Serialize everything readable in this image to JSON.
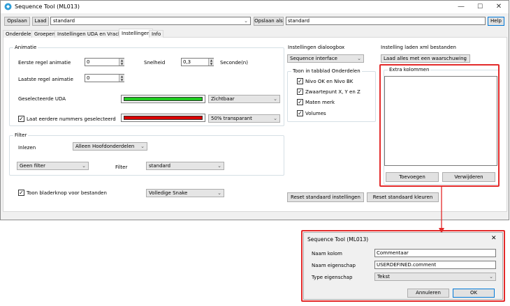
{
  "window": {
    "title": "Sequence Tool (ML013)",
    "minimize": "—",
    "maximize": "☐",
    "close": "✕"
  },
  "toolbar": {
    "save_label": "Opslaan",
    "load_label": "Laad",
    "profile_value": "standard",
    "save_as_label": "Opslaan als",
    "save_as_value": "standard",
    "help_label": "Help"
  },
  "tabs": [
    {
      "label": "Onderdelen"
    },
    {
      "label": "Groepen"
    },
    {
      "label": "Instellingen UDA en Vrachten"
    },
    {
      "label": "Instellingen"
    },
    {
      "label": "Info"
    }
  ],
  "animatie": {
    "title": "Animatie",
    "first_line_label": "Eerste regel animatie",
    "first_line_value": "0",
    "speed_label": "Snelheid",
    "speed_value": "0,3",
    "speed_unit": "Seconde(n)",
    "last_line_label": "Laatste regel animatie",
    "last_line_value": "0",
    "selected_uda_label": "Geselecteerde UDA",
    "selected_uda_color": "#22cc22",
    "selected_uda_mode": "Zichtbaar",
    "last_numbers_label": "Laat eerdere nummers geselecteerd",
    "last_numbers_checked": true,
    "last_numbers_color": "#d90000",
    "last_numbers_mode": "50% transparant"
  },
  "filter": {
    "title": "Filter",
    "read_label": "Inlezen",
    "read_value": "Alleen Hoofdonderdelen",
    "filter_mode_value": "Geen filter",
    "filter_label": "Filter",
    "filter_value": "standard"
  },
  "browse": {
    "label": "Toon bladerknop voor bestanden",
    "checked": true,
    "snake_value": "Volledige Snake"
  },
  "dialog_settings": {
    "title": "Instellingen dialoogbox",
    "value": "Sequence interface",
    "tab_group_title": "Toon in tabblad Onderdelen",
    "items": [
      {
        "label": "Nivo OK en Nivo BK",
        "checked": true
      },
      {
        "label": "Zwaartepunt X, Y en Z",
        "checked": true
      },
      {
        "label": "Maten merk",
        "checked": true
      },
      {
        "label": "Volumes",
        "checked": true
      }
    ]
  },
  "xml": {
    "title": "Instelling laden xml bestanden",
    "value": "Laad alles met een waarschuwing",
    "extra_title": "Extra kolommen",
    "add_label": "Toevoegen",
    "remove_label": "Verwijderen"
  },
  "reset": {
    "settings_label": "Reset standaard instellingen",
    "colors_label": "Reset standaard kleuren"
  },
  "popup": {
    "title": "Sequence Tool (ML013)",
    "close": "✕",
    "name_label": "Naam kolom",
    "name_value": "Commentaar",
    "prop_label": "Naam eigenschap",
    "prop_value": "USERDEFINED.comment",
    "type_label": "Type eigenschap",
    "type_value": "Tekst",
    "cancel_label": "Annuleren",
    "ok_label": "OK"
  },
  "colors": {
    "highlight": "#e32a2a",
    "accent": "#0078d7"
  }
}
